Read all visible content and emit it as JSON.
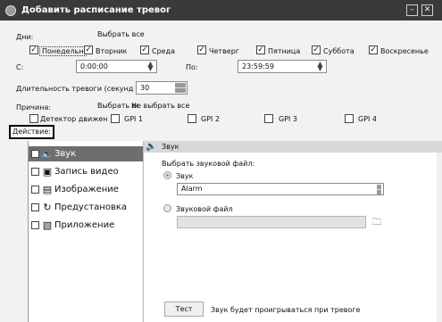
{
  "window": {
    "title": "Добавить расписание тревог",
    "min_label": "–",
    "close_label": "✕"
  },
  "days": {
    "label": "Дни:",
    "select_all": "Выбрать все",
    "items": [
      {
        "label": "Понедельн",
        "checked": "✓"
      },
      {
        "label": "Вторник",
        "checked": "✓"
      },
      {
        "label": "Среда",
        "checked": "✓"
      },
      {
        "label": "Четверг",
        "checked": "✓"
      },
      {
        "label": "Пятница",
        "checked": "✓"
      },
      {
        "label": "Суббота",
        "checked": "✓"
      },
      {
        "label": "Воскресенье",
        "checked": "✓"
      }
    ]
  },
  "time": {
    "from_label": "С:",
    "from_value": "0:00:00",
    "to_label": "По:",
    "to_value": "23:59:59"
  },
  "duration": {
    "label": "Длительность тревоги (секунды):",
    "value": "30"
  },
  "reason": {
    "label": "Причина:",
    "select_all": "Выбрать все",
    "deselect_all": "Не выбрать все",
    "items": [
      "Детектор движения",
      "GPI 1",
      "GPI 2",
      "GPI 3",
      "GPI 4"
    ]
  },
  "action": {
    "label": "Действие:",
    "items": [
      {
        "label": "Звук",
        "icon": "speaker-icon"
      },
      {
        "label": "Запись видео",
        "icon": "video-camera-icon"
      },
      {
        "label": "Изображение",
        "icon": "image-icon"
      },
      {
        "label": "Предустановка",
        "icon": "preset-icon"
      },
      {
        "label": "Приложение",
        "icon": "application-icon"
      }
    ]
  },
  "sound_panel": {
    "header": "Звук",
    "choose_label": "Выбрать звуковой файл:",
    "option_sound": "Звук",
    "sound_value": "Alarm",
    "option_file": "Звуковой файл",
    "file_value": "",
    "test_button": "Тест",
    "hint": "Звук будет проигрываться при тревоге"
  }
}
